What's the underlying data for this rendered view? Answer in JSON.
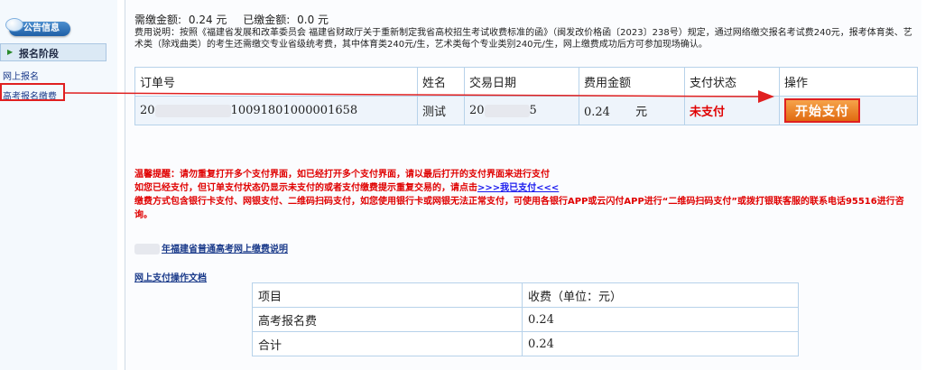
{
  "sidebar": {
    "announcement_label": "公告信息",
    "stage_label": "报名阶段",
    "links": [
      "网上报名",
      "高考报名缴费"
    ]
  },
  "summary": {
    "due_label": "需缴金额:",
    "due_value": "0.24 元",
    "paid_label": "已缴金额:",
    "paid_value": "0.0 元"
  },
  "fee_note": "费用说明：按照《福建省发展和改革委员会 福建省财政厅关于重新制定我省高校招生考试收费标准的函》（闽发改价格函〔2023〕238号）规定，通过网络缴交报名考试费240元，报考体育类、艺术类（除戏曲类）的考生还需缴交专业省级统考费，其中体育类240元/生，艺术类每个专业类别240元/生，网上缴费成功后方可参加现场确认。",
  "order_table": {
    "headers": [
      "订单号",
      "姓名",
      "交易日期",
      "费用金额",
      "支付状态",
      "操作"
    ],
    "row": {
      "order_prefix": "20",
      "order_suffix": "10091801000001658",
      "name": "测试",
      "date_prefix": "20",
      "date_suffix": "5",
      "amount": "0.24",
      "currency": "元",
      "status": "未支付",
      "action": "开始支付"
    }
  },
  "tips": {
    "line1": "温馨提醒：请勿重复打开多个支付界面，如已经打开多个支付界面，请以最后打开的支付界面来进行支付",
    "line2_text": "如您已经支付，但订单支付状态仍显示未支付的或者支付缴费提示重复交易的，请点击",
    "line2_link": ">>>我已支付<<<",
    "line3": "缴费方式包含银行卡支付、网银支付、二维码扫码支付，如您使用银行卡或网银无法正常支付，可使用各银行APP或云闪付APP进行“二维码扫码支付”或拨打银联客服的联系电话95516进行咨询。"
  },
  "links": {
    "exam_payment_desc": "年福建省普通高考网上缴费说明",
    "payment_doc": "网上支付操作文档"
  },
  "fee_table": {
    "headers": [
      "项目",
      "收费（单位：元）"
    ],
    "rows": [
      [
        "高考报名费",
        "0.24"
      ],
      [
        "合计",
        "0.24"
      ]
    ]
  },
  "colors": {
    "unpaid": "#e00000",
    "pay_button": "#e8761c",
    "annotation_red": "#e02020",
    "link_blue": "#1a3a8a"
  }
}
